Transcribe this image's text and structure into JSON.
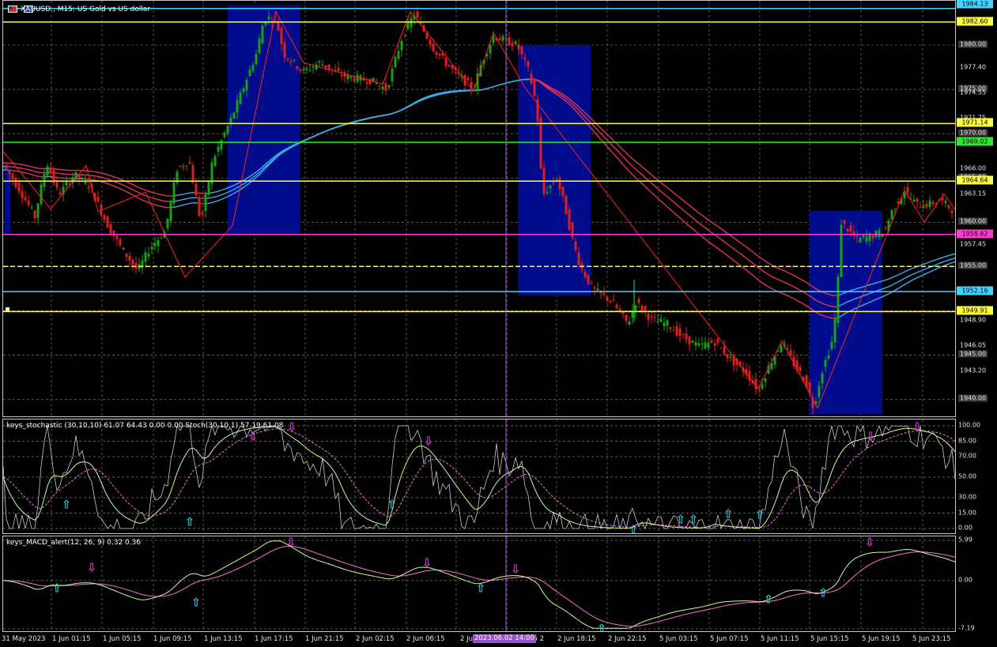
{
  "window": {
    "title": "XAUUSD., M15:  US Gold vs US dollar"
  },
  "colors": {
    "bull": "#18a018",
    "bear": "#e01e1e",
    "box": "#000c8c",
    "ema_blue": "#3ca8e8",
    "ema_red": "#e0305a",
    "stoch_main": "#c8ff8c",
    "stoch_signal": "#ff6ed2",
    "stoch_raw": "#c8c8d4",
    "grid": "#7a7a7a"
  },
  "price_axis": {
    "ticks": [
      "1980.00",
      "1977.40",
      "1975.00",
      "1974.55",
      "1971.75",
      "1970.00",
      "1966.00",
      "1965.00",
      "1963.15",
      "1960.00",
      "1957.45",
      "1955.00",
      "1950.00",
      "1948.90",
      "1946.05",
      "1945.00",
      "1943.20",
      "1940.00"
    ],
    "tags": [
      {
        "label": "1984.13",
        "color": "#46d2ff"
      },
      {
        "label": "1982.60",
        "color": "#ffff3c"
      },
      {
        "label": "1971.14",
        "color": "#ffff3c"
      },
      {
        "label": "1969.02",
        "color": "#32e632"
      },
      {
        "label": "1964.64",
        "color": "#ffff3c"
      },
      {
        "label": "1958.62",
        "color": "#ff3cd2"
      },
      {
        "label": "1952.16",
        "color": "#46d2ff"
      },
      {
        "label": "1949.91",
        "color": "#ffff3c"
      }
    ]
  },
  "levels": [
    {
      "price": 1984.13,
      "color": "#46d2ff"
    },
    {
      "price": 1982.6,
      "color": "#ffff3c"
    },
    {
      "price": 1971.14,
      "color": "#ffff3c"
    },
    {
      "price": 1969.02,
      "color": "#32e632"
    },
    {
      "price": 1964.64,
      "color": "#ffff3c"
    },
    {
      "price": 1958.62,
      "color": "#ff3cd2"
    },
    {
      "price": 1955.0,
      "color": "#ffff3c",
      "dashed": true
    },
    {
      "price": 1952.16,
      "color": "#46d2ff"
    },
    {
      "price": 1949.91,
      "color": "#ffff3c"
    }
  ],
  "stochastic": {
    "title": "keys_stochastic (30,10,10) 61.07 64.43 0.00 0.00 Stoch(30,10,1) 57.19 61.08",
    "ticks": [
      "100.00",
      "85.00",
      "70.00",
      "50.00",
      "30.00",
      "15.00",
      "0.00"
    ]
  },
  "macd": {
    "title": "keys_MACD_alert(12, 26, 9) 0.32 0.36",
    "ticks": [
      "5.99",
      "0.00",
      "-7.19"
    ]
  },
  "time_axis": {
    "labels": [
      "31 May 2023",
      "1 Jun 01:15",
      "1 Jun 05:15",
      "1 Jun 09:15",
      "1 Jun 13:15",
      "1 Jun 17:15",
      "1 Jun 21:15",
      "2 Jun 02:15",
      "2 Jun 06:15",
      "2 Jun 10:15",
      "2 Jun 14:15",
      "2 Jun 18:15",
      "2 Jun 22:15",
      "5 Jun 03:15",
      "5 Jun 07:15",
      "5 Jun 11:15",
      "5 Jun 15:15",
      "5 Jun 19:15",
      "5 Jun 23:15"
    ],
    "crosshair": "2023.06.02 14:00"
  },
  "chart_data": {
    "type": "candlestick",
    "symbol": "XAUUSD.",
    "timeframe": "M15",
    "ylim": [
      1937.9,
      1985.0
    ],
    "anchors": [
      [
        0,
        1966.5
      ],
      [
        20,
        1963.8
      ],
      [
        40,
        1960.6
      ],
      [
        55,
        1966.8
      ],
      [
        70,
        1963.1
      ],
      [
        90,
        1965.4
      ],
      [
        110,
        1964.0
      ],
      [
        130,
        1960.0
      ],
      [
        150,
        1957.0
      ],
      [
        170,
        1954.5
      ],
      [
        185,
        1957.0
      ],
      [
        205,
        1959.0
      ],
      [
        220,
        1966.0
      ],
      [
        235,
        1967.0
      ],
      [
        250,
        1960.0
      ],
      [
        265,
        1967.0
      ],
      [
        290,
        1972.0
      ],
      [
        320,
        1979.0
      ],
      [
        330,
        1983.0
      ],
      [
        345,
        1983.0
      ],
      [
        355,
        1979.0
      ],
      [
        380,
        1977.0
      ],
      [
        400,
        1978.0
      ],
      [
        430,
        1976.5
      ],
      [
        465,
        1976.0
      ],
      [
        485,
        1975.0
      ],
      [
        505,
        1981.0
      ],
      [
        520,
        1983.5
      ],
      [
        545,
        1979.5
      ],
      [
        570,
        1977.0
      ],
      [
        595,
        1975.0
      ],
      [
        605,
        1978.0
      ],
      [
        620,
        1981.0
      ],
      [
        650,
        1980.0
      ],
      [
        665,
        1977.0
      ],
      [
        675,
        1973.0
      ],
      [
        682,
        1963.0
      ],
      [
        700,
        1965.0
      ],
      [
        710,
        1962.0
      ],
      [
        720,
        1958.0
      ],
      [
        730,
        1955.0
      ],
      [
        745,
        1952.5
      ],
      [
        770,
        1951.0
      ],
      [
        790,
        1948.5
      ],
      [
        800,
        1951.0
      ],
      [
        820,
        1949.0
      ],
      [
        840,
        1948.5
      ],
      [
        860,
        1947.0
      ],
      [
        880,
        1946.0
      ],
      [
        900,
        1946.5
      ],
      [
        920,
        1944.5
      ],
      [
        940,
        1943.0
      ],
      [
        955,
        1941.0
      ],
      [
        970,
        1944.0
      ],
      [
        985,
        1946.5
      ],
      [
        1000,
        1944.0
      ],
      [
        1015,
        1942.0
      ],
      [
        1025,
        1939.0
      ],
      [
        1035,
        1943.0
      ],
      [
        1050,
        1947.0
      ],
      [
        1055,
        1952.0
      ],
      [
        1060,
        1960.0
      ],
      [
        1080,
        1958.0
      ],
      [
        1100,
        1958.5
      ],
      [
        1115,
        1959.0
      ],
      [
        1125,
        1961.5
      ],
      [
        1140,
        1963.5
      ],
      [
        1155,
        1962.0
      ],
      [
        1170,
        1962.0
      ],
      [
        1185,
        1962.5
      ],
      [
        1206,
        1961.0
      ]
    ],
    "boxes": [
      {
        "x0": 1946.0,
        "x1": 1973.0,
        "label": ""
      }
    ],
    "box_ranges": [
      [
        1966.2,
        1958.6
      ],
      [
        1984.5,
        1958.6
      ],
      [
        1980.0,
        1951.7
      ],
      [
        1961.3,
        1938.3
      ]
    ],
    "zigzag": [
      [
        0,
        1968.0
      ],
      [
        60,
        1961.5
      ],
      [
        105,
        1966.4
      ],
      [
        120,
        1961.2
      ],
      [
        180,
        1963.4
      ],
      [
        230,
        1953.8
      ],
      [
        290,
        1959.6
      ],
      [
        345,
        1983.8
      ],
      [
        380,
        1978.0
      ],
      [
        480,
        1975.6
      ],
      [
        515,
        1983.8
      ],
      [
        595,
        1974.8
      ],
      [
        620,
        1981.4
      ],
      [
        660,
        1975.2
      ],
      [
        955,
        1941.2
      ],
      [
        985,
        1946.6
      ],
      [
        1030,
        1939.0
      ],
      [
        1140,
        1963.6
      ],
      [
        1165,
        1960.0
      ],
      [
        1190,
        1963.2
      ],
      [
        1206,
        1961.2
      ]
    ]
  }
}
